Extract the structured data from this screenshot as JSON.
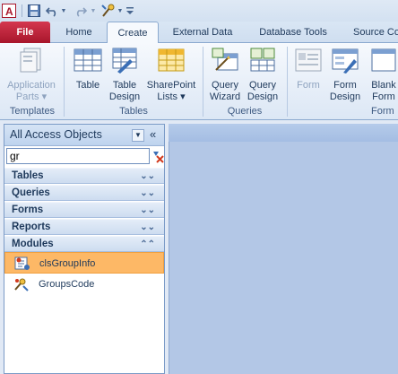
{
  "tabs": {
    "file": "File",
    "home": "Home",
    "create": "Create",
    "external": "External Data",
    "dbtools": "Database Tools",
    "source": "Source Co"
  },
  "ribbon": {
    "app_parts_1": "Application",
    "app_parts_2": "Parts ▾",
    "table": "Table",
    "table_design_1": "Table",
    "table_design_2": "Design",
    "sharepoint_1": "SharePoint",
    "sharepoint_2": "Lists ▾",
    "query_wizard_1": "Query",
    "query_wizard_2": "Wizard",
    "query_design_1": "Query",
    "query_design_2": "Design",
    "form": "Form",
    "form_design_1": "Form",
    "form_design_2": "Design",
    "blank_form_1": "Blank",
    "blank_form_2": "Form",
    "groups": {
      "templates": "Templates",
      "tables": "Tables",
      "queries": "Queries",
      "forms": "Form"
    }
  },
  "nav": {
    "header": "All Access Objects",
    "search_value": "gr",
    "categories": [
      "Tables",
      "Queries",
      "Forms",
      "Reports",
      "Modules"
    ],
    "items": [
      "clsGroupInfo",
      "GroupsCode"
    ]
  }
}
